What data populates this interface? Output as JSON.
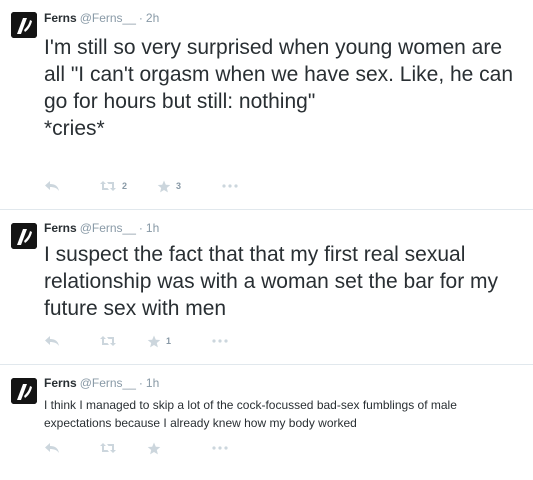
{
  "colors": {
    "text": "#292f33",
    "meta": "#8899a6",
    "icon": "#ccd6dd",
    "divider": "#e1e8ed"
  },
  "tweets": [
    {
      "name": "Ferns",
      "handle": "@Ferns__",
      "separator": "·",
      "time": "2h",
      "text": "I'm still so very surprised when young women are all \"I can't orgasm when we have sex. Like, he can go for hours but still: nothing\"\n*cries*",
      "retweets": "2",
      "favorites": "3"
    },
    {
      "name": "Ferns",
      "handle": "@Ferns__",
      "separator": "·",
      "time": "1h",
      "text": "I suspect the fact that that my first real sexual relationship was with a woman set the bar for my future sex with men",
      "retweets": "",
      "favorites": "1"
    },
    {
      "name": "Ferns",
      "handle": "@Ferns__",
      "separator": "·",
      "time": "1h",
      "text": "I think I managed to skip a lot of the cock-focussed bad-sex fumblings of male expectations because I already knew how my body worked",
      "retweets": "",
      "favorites": ""
    }
  ]
}
